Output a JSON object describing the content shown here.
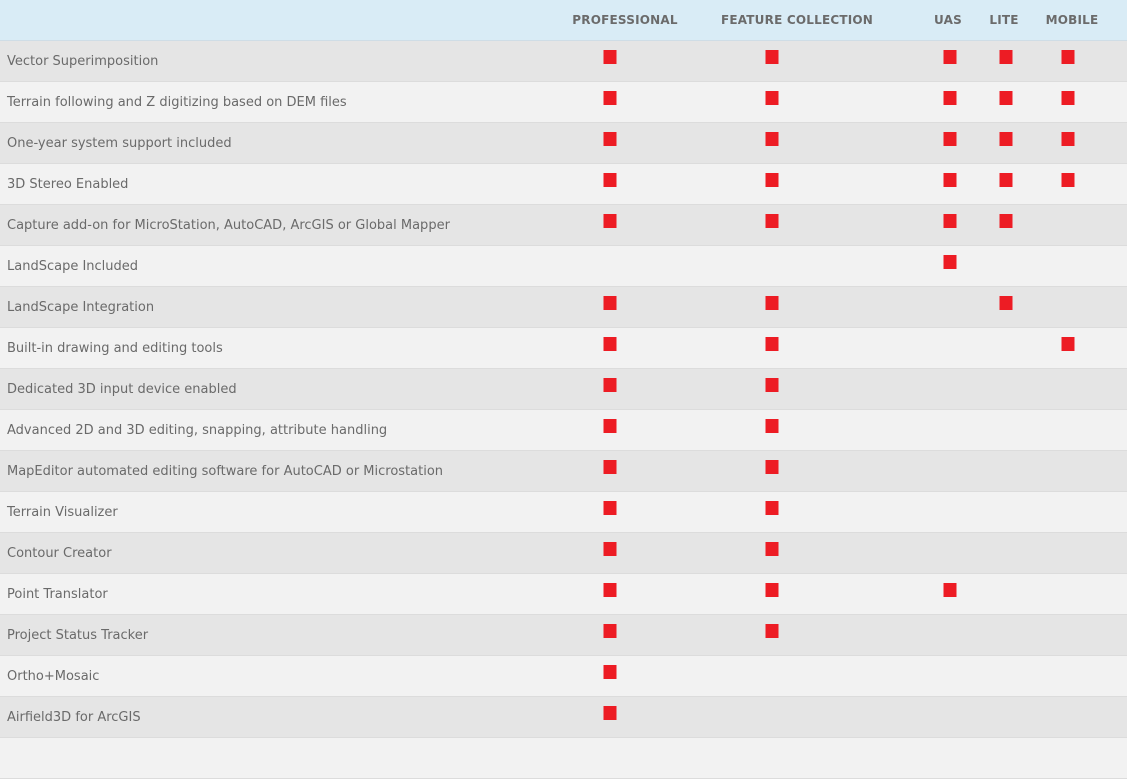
{
  "columns": [
    "PROFESSIONAL",
    "FEATURE COLLECTION",
    "UAS",
    "LITE",
    "MOBILE"
  ],
  "mark_color": "#ed1c24",
  "mark_icon": "red-square",
  "rows": [
    {
      "feature": "Vector Superimposition",
      "included": [
        true,
        true,
        true,
        true,
        true
      ]
    },
    {
      "feature": "Terrain following and Z digitizing based on DEM files",
      "included": [
        true,
        true,
        true,
        true,
        true
      ]
    },
    {
      "feature": "One-year system support included",
      "included": [
        true,
        true,
        true,
        true,
        true
      ]
    },
    {
      "feature": "3D Stereo Enabled",
      "included": [
        true,
        true,
        true,
        true,
        true
      ]
    },
    {
      "feature": "Capture add-on for MicroStation, AutoCAD, ArcGIS or Global Mapper",
      "included": [
        true,
        true,
        true,
        true,
        false
      ]
    },
    {
      "feature": "LandScape Included",
      "included": [
        false,
        false,
        true,
        false,
        false
      ]
    },
    {
      "feature": "LandScape Integration",
      "included": [
        true,
        true,
        false,
        true,
        false
      ]
    },
    {
      "feature": "Built-in drawing and editing tools",
      "included": [
        true,
        true,
        false,
        false,
        true
      ]
    },
    {
      "feature": "Dedicated 3D input device enabled",
      "included": [
        true,
        true,
        false,
        false,
        false
      ]
    },
    {
      "feature": "Advanced 2D and 3D editing, snapping, attribute handling",
      "included": [
        true,
        true,
        false,
        false,
        false
      ]
    },
    {
      "feature": "MapEditor automated editing software for AutoCAD or Microstation",
      "included": [
        true,
        true,
        false,
        false,
        false
      ]
    },
    {
      "feature": "Terrain Visualizer",
      "included": [
        true,
        true,
        false,
        false,
        false
      ]
    },
    {
      "feature": "Contour Creator",
      "included": [
        true,
        true,
        false,
        false,
        false
      ]
    },
    {
      "feature": "Point Translator",
      "included": [
        true,
        true,
        true,
        false,
        false
      ]
    },
    {
      "feature": "Project Status Tracker",
      "included": [
        true,
        true,
        false,
        false,
        false
      ]
    },
    {
      "feature": "Ortho+Mosaic",
      "included": [
        true,
        false,
        false,
        false,
        false
      ]
    },
    {
      "feature": "Airfield3D for ArcGIS",
      "included": [
        true,
        false,
        false,
        false,
        false
      ]
    },
    {
      "feature": "",
      "included": [
        false,
        false,
        false,
        false,
        false
      ]
    }
  ]
}
